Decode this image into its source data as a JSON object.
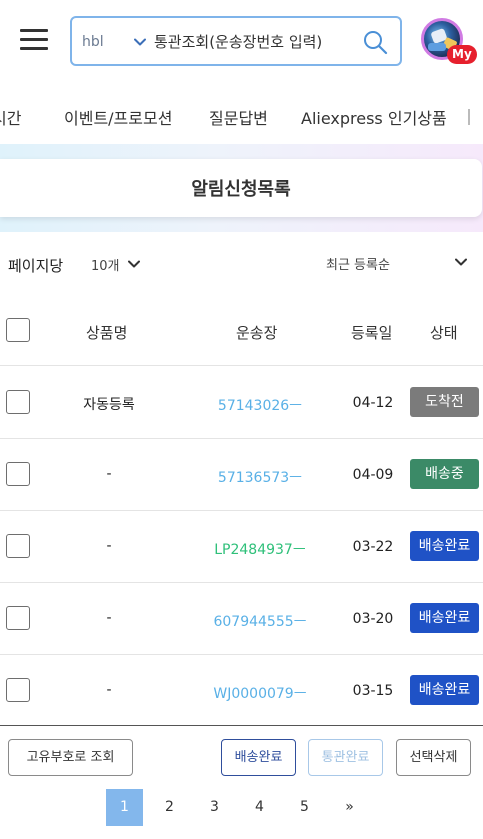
{
  "header": {
    "search": {
      "select_value": "hbl",
      "placeholder": "통관조회(운송장번호 입력)"
    },
    "my_badge": "My",
    "icons": {
      "menu": "hamburger-menu-icon",
      "dropdown": "chevron-down-icon",
      "search": "search-icon"
    }
  },
  "nav": {
    "items": [
      {
        "label": "시간"
      },
      {
        "label": "이벤트/프로모션"
      },
      {
        "label": "질문답변"
      },
      {
        "label": "Aliexpress 인기상품"
      }
    ]
  },
  "page": {
    "title": "알림신청목록"
  },
  "filters": {
    "per_page_label": "페이지당",
    "per_page_value": "10개",
    "sort_value": "최근 등록순"
  },
  "table": {
    "headers": {
      "product": "상품명",
      "tracking": "운송장",
      "date": "등록일",
      "status": "상태"
    },
    "rows": [
      {
        "product": "자동등록",
        "tracking": "57143026ㅡ",
        "date": "04-12",
        "status": "도착전"
      },
      {
        "product": "-",
        "tracking": "57136573ㅡ",
        "date": "04-09",
        "status": "배송중"
      },
      {
        "product": "-",
        "tracking": "LP2484937ㅡ",
        "date": "03-22",
        "status": "배송완료"
      },
      {
        "product": "-",
        "tracking": "607944555ㅡ",
        "date": "03-20",
        "status": "배송완료"
      },
      {
        "product": "-",
        "tracking": "WJ0000079ㅡ",
        "date": "03-15",
        "status": "배송완료"
      }
    ]
  },
  "actions": {
    "unique_lookup": "고유부호로 조회",
    "delivered": "배송완료",
    "customs_done": "통관완료",
    "delete_selected": "선택삭제"
  },
  "pagination": {
    "pages": [
      "1",
      "2",
      "3",
      "4",
      "5"
    ],
    "next": "»",
    "current": "1"
  },
  "colors": {
    "status_before_arrival": "#7b7b7b",
    "status_in_transit": "#3b8a67",
    "status_delivered": "#1f52c6",
    "tracking_link": "#59b0e6",
    "tracking_link_lp": "#2fc07a",
    "search_border": "#7fb4ea",
    "pagination_active": "#83b7ec",
    "my_badge": "#e6202d"
  }
}
